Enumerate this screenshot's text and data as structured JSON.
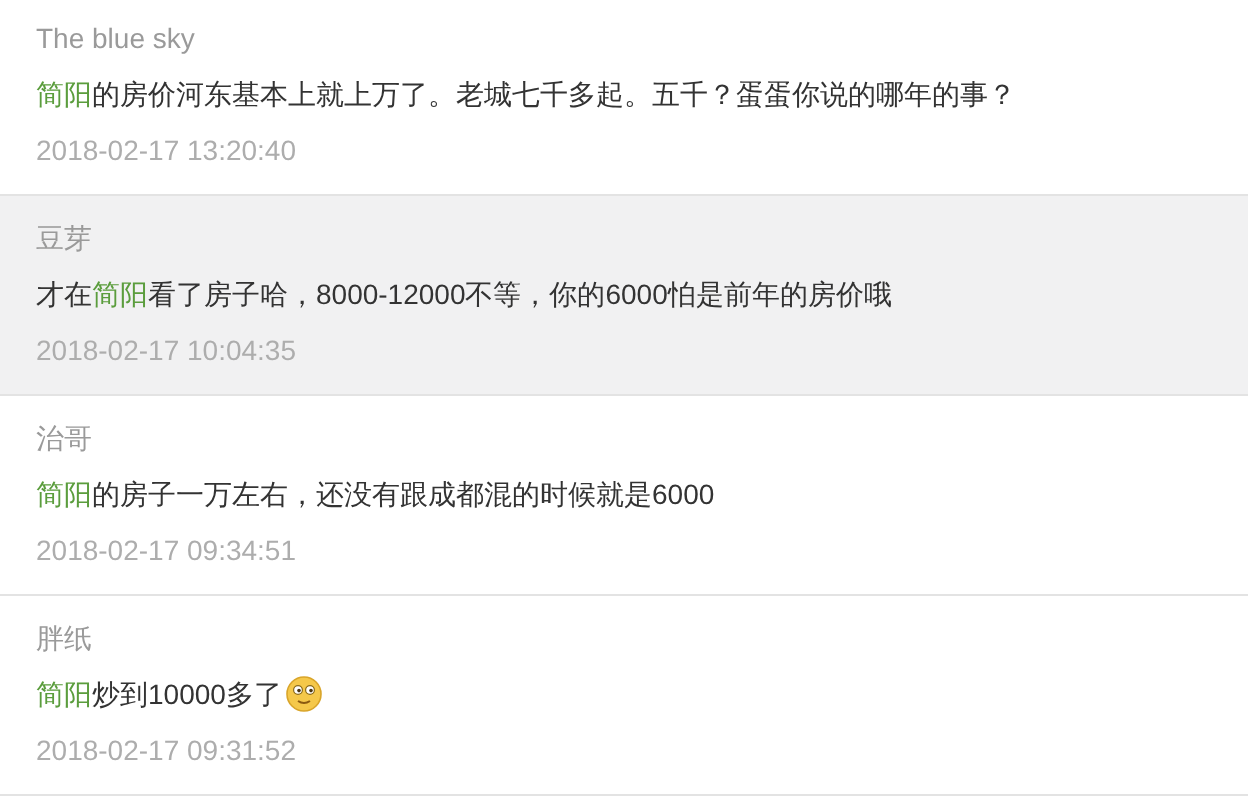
{
  "comments": [
    {
      "author": "The blue sky",
      "shaded": false,
      "body": [
        {
          "kind": "link",
          "text": "简阳"
        },
        {
          "kind": "text",
          "text": "的房价河东基本上就上万了。老城七千多起。五千？蛋蛋你说的哪年的事？"
        }
      ],
      "time": "2018-02-17 13:20:40"
    },
    {
      "author": "豆芽",
      "shaded": true,
      "body": [
        {
          "kind": "text",
          "text": "才在"
        },
        {
          "kind": "link",
          "text": "简阳"
        },
        {
          "kind": "text",
          "text": "看了房子哈，8000-12000不等，你的6000怕是前年的房价哦"
        }
      ],
      "time": "2018-02-17 10:04:35"
    },
    {
      "author": "治哥",
      "shaded": false,
      "body": [
        {
          "kind": "link",
          "text": "简阳"
        },
        {
          "kind": "text",
          "text": "的房子一万左右，还没有跟成都混的时候就是6000"
        }
      ],
      "time": "2018-02-17 09:34:51"
    },
    {
      "author": "胖纸",
      "shaded": false,
      "body": [
        {
          "kind": "link",
          "text": "简阳"
        },
        {
          "kind": "text",
          "text": "炒到10000多了"
        },
        {
          "kind": "emoji"
        }
      ],
      "time": "2018-02-17 09:31:52"
    }
  ]
}
